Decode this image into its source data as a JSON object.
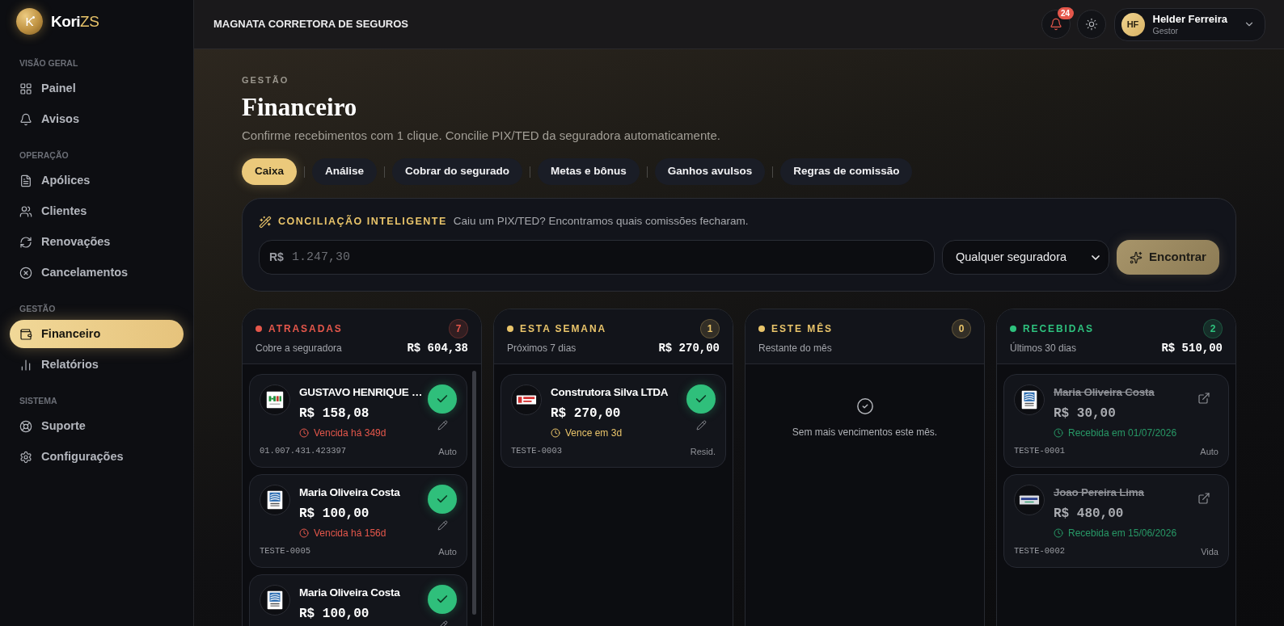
{
  "sidebar": {
    "brand": {
      "mark": "K",
      "name": "Kori",
      "name_accent": "ZS"
    },
    "sections": [
      {
        "title": "VISÃO GERAL",
        "items": [
          {
            "label": "Painel",
            "selected": false
          },
          {
            "label": "Avisos",
            "selected": false
          }
        ]
      },
      {
        "title": "OPERAÇÃO",
        "items": [
          {
            "label": "Apólices",
            "selected": false
          },
          {
            "label": "Clientes",
            "selected": false
          },
          {
            "label": "Renovações",
            "selected": false
          },
          {
            "label": "Cancelamentos",
            "selected": false
          }
        ]
      },
      {
        "title": "GESTÃO",
        "items": [
          {
            "label": "Financeiro",
            "selected": true
          },
          {
            "label": "Relatórios",
            "selected": false
          }
        ]
      },
      {
        "title": "SISTEMA",
        "items": [
          {
            "label": "Suporte",
            "selected": false
          },
          {
            "label": "Configurações",
            "selected": false
          }
        ]
      }
    ]
  },
  "header": {
    "title": "MAGNATA CORRETORA DE SEGUROS",
    "notification_count": "24",
    "user": {
      "initials": "HF",
      "name": "Helder Ferreira",
      "role": "Gestor"
    }
  },
  "page": {
    "eyebrow": "GESTÃO",
    "title": "Financeiro",
    "subtitle": "Confirme recebimentos com 1 clique. Concilie PIX/TED da seguradora automaticamente."
  },
  "tabs": [
    {
      "label": "Caixa",
      "selected": true
    },
    {
      "label": "Análise",
      "selected": false
    },
    {
      "label": "Cobrar do segurado",
      "selected": false
    },
    {
      "label": "Metas e bônus",
      "selected": false
    },
    {
      "label": "Ganhos avulsos",
      "selected": false
    },
    {
      "label": "Regras de comissão",
      "selected": false
    }
  ],
  "reconciliation": {
    "title": "CONCILIAÇÃO INTELIGENTE",
    "hint": "Caiu um PIX/TED? Encontramos quais comissões fecharam.",
    "currency": "R$",
    "amount_placeholder": "1.247,30",
    "insurer_select": "Qualquer seguradora",
    "button": "Encontrar"
  },
  "columns": [
    {
      "title": "ATRASADAS",
      "color": "#e5574b",
      "count": "7",
      "subtitle": "Cobre a seguradora",
      "total": "R$ 604,38",
      "cards": [
        {
          "logo": {
            "kind": "bars"
          },
          "name": "GUSTAVO HENRIQUE …",
          "amount": "R$ 158,08",
          "status": "Vencida há 349d",
          "reference": "01.007.431.423397",
          "line": "Auto",
          "received": false
        },
        {
          "logo": {
            "kind": "wave"
          },
          "name": "Maria Oliveira Costa",
          "amount": "R$ 100,00",
          "status": "Vencida há 156d",
          "reference": "TESTE-0005",
          "line": "Auto",
          "received": false
        },
        {
          "logo": {
            "kind": "wave"
          },
          "name": "Maria Oliveira Costa",
          "amount": "R$ 100,00",
          "received": false
        }
      ]
    },
    {
      "title": "ESTA SEMANA",
      "color": "#e9c46a",
      "count": "1",
      "subtitle": "Próximos 7 dias",
      "total": "R$ 270,00",
      "cards": [
        {
          "logo": {
            "kind": "banner"
          },
          "name": "Construtora Silva LTDA",
          "amount": "R$ 270,00",
          "status": "Vence em 3d",
          "reference": "TESTE-0003",
          "line": "Resid.",
          "received": false
        }
      ]
    },
    {
      "title": "ESTE MÊS",
      "color": "#e9c46a",
      "count": "0",
      "subtitle": "Restante do mês",
      "empty_text": "Sem mais vencimentos este mês."
    },
    {
      "title": "RECEBIDAS",
      "color": "#2ec27e",
      "count": "2",
      "subtitle": "Últimos 30 dias",
      "total": "R$ 510,00",
      "cards": [
        {
          "logo": {
            "kind": "wave"
          },
          "name": "Maria Oliveira Costa",
          "amount": "R$ 30,00",
          "status": "Recebida em 01/07/2026",
          "reference": "TESTE-0001",
          "line": "Auto",
          "received": true
        },
        {
          "logo": {
            "kind": "wordmark"
          },
          "name": "Joao Pereira Lima",
          "amount": "R$ 480,00",
          "status": "Recebida em 15/06/2026",
          "reference": "TESTE-0002",
          "line": "Vida",
          "received": true
        }
      ]
    }
  ]
}
